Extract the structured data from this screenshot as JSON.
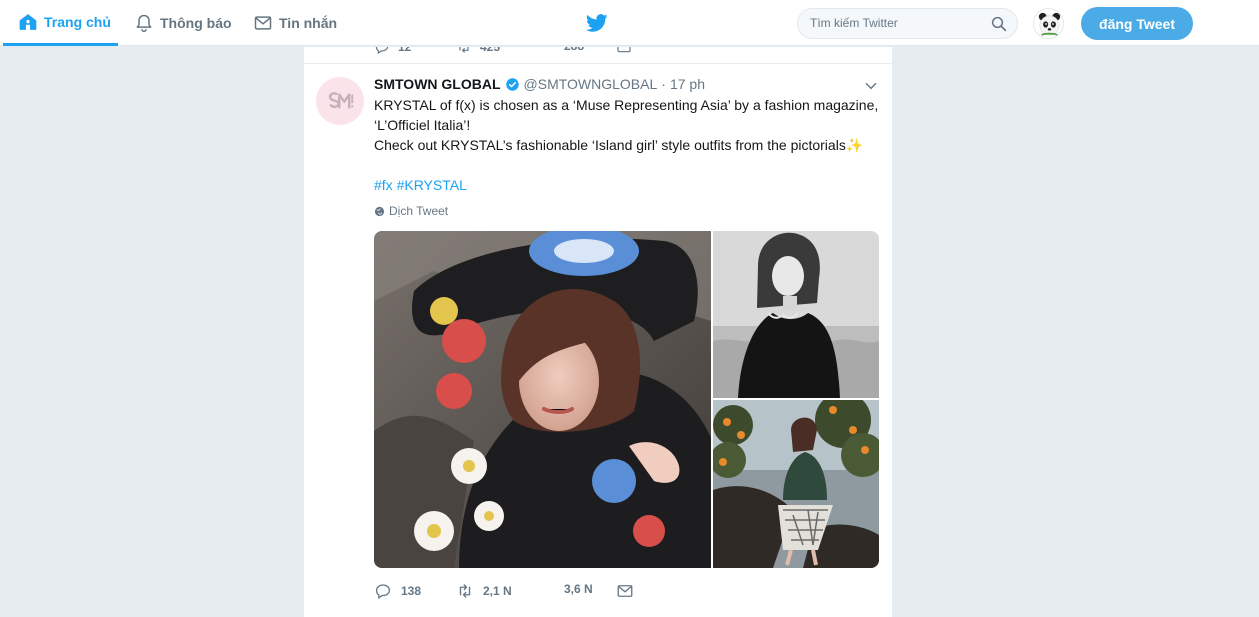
{
  "nav": {
    "home_label": "Trang chủ",
    "notifications_label": "Thông báo",
    "messages_label": "Tin nhắn"
  },
  "search": {
    "placeholder": "Tìm kiếm Twitter"
  },
  "tweet_button_label": "đăng Tweet",
  "previous_tweet": {
    "replies": "12",
    "retweets": "425",
    "likes": "288"
  },
  "tweet": {
    "name": "SMTOWN GLOBAL",
    "handle": "@SMTOWNGLOBAL",
    "separator": "·",
    "time": "17 ph",
    "text_line1": "KRYSTAL of f(x) is chosen as a ‘Muse Representing Asia’ by a fashion magazine, ‘L’Officiel Italia’!",
    "text_line2": "Check out KRYSTAL’s fashionable ‘Island girl’ style outfits from the pictorials✨",
    "hashtags": "#fx #KRYSTAL",
    "translate_label": "Dịch Tweet",
    "replies": "138",
    "retweets": "2,1 N",
    "likes": "3,6 N"
  },
  "colors": {
    "accent": "#1da1f2",
    "tweet_button": "#4aabe7",
    "page_bg": "#e6ecf0",
    "muted_text": "#657786"
  }
}
